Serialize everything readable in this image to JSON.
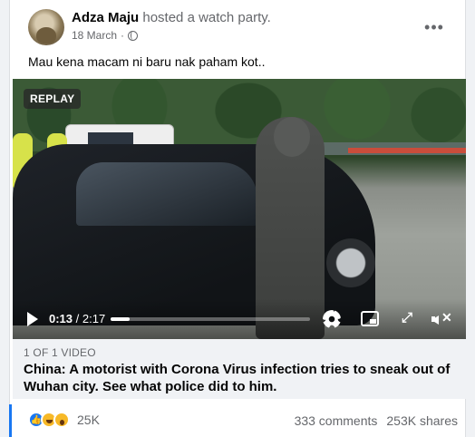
{
  "post": {
    "author": "Adza Maju",
    "action": "hosted a watch party.",
    "date": "18 March",
    "separator": "·",
    "more_icon": "more-horizontal-icon",
    "caption": "Mau kena macam ni baru nak paham kot.."
  },
  "video": {
    "badge": "REPLAY",
    "current_time": "0:13",
    "time_separator": " / ",
    "duration": "2:17",
    "progress_fraction": 0.095,
    "count_label": "1 OF 1 VIDEO",
    "title": "China: A motorist with Corona Virus infection tries to sneak out of Wuhan city. See what police did to him.",
    "fullscreen_glyph": "⤢",
    "mute_glyph": "✕"
  },
  "stats": {
    "reaction_count": "25K",
    "comments": "333 comments",
    "shares": "253K shares"
  },
  "colors": {
    "accent": "#1877f2",
    "secondary_text": "#65676b"
  }
}
